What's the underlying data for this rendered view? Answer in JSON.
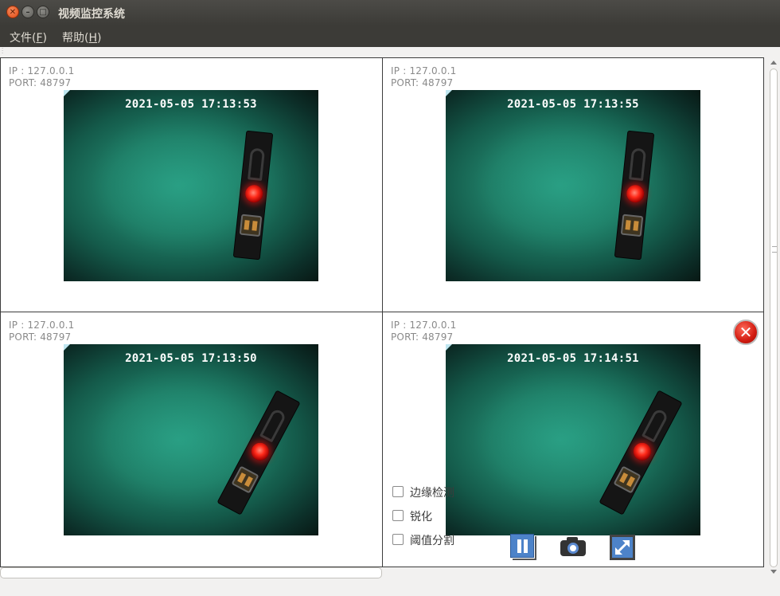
{
  "window": {
    "title": "视频监控系统",
    "close_glyph": "✕",
    "min_glyph": "–",
    "max_glyph": "□"
  },
  "menu": [
    {
      "label": "文件",
      "accel": "F"
    },
    {
      "label": "帮助",
      "accel": "H"
    }
  ],
  "panels": [
    {
      "ip": "IP  : 127.0.0.1",
      "port": "PORT: 48797",
      "timestamp": "2021-05-05 17:13:53"
    },
    {
      "ip": "IP  : 127.0.0.1",
      "port": "PORT: 48797",
      "timestamp": "2021-05-05 17:13:55"
    },
    {
      "ip": "IP  : 127.0.0.1",
      "port": "PORT: 48797",
      "timestamp": "2021-05-05 17:13:50"
    },
    {
      "ip": "IP  : 127.0.0.1",
      "port": "PORT: 48797",
      "timestamp": "2021-05-05 17:14:51"
    }
  ],
  "overlay": {
    "close_glyph": "✕",
    "options": [
      {
        "label": "边缘检测",
        "checked": false
      },
      {
        "label": "锐化",
        "checked": false
      },
      {
        "label": "阈值分割",
        "checked": false
      }
    ],
    "controls": [
      "pause-icon",
      "camera-icon",
      "expand-icon"
    ]
  },
  "colors": {
    "titlebar": "#3c3b37",
    "accent_blue": "#4d83c9",
    "close_red": "#d11b10",
    "feed_green": "#1f7d66"
  }
}
